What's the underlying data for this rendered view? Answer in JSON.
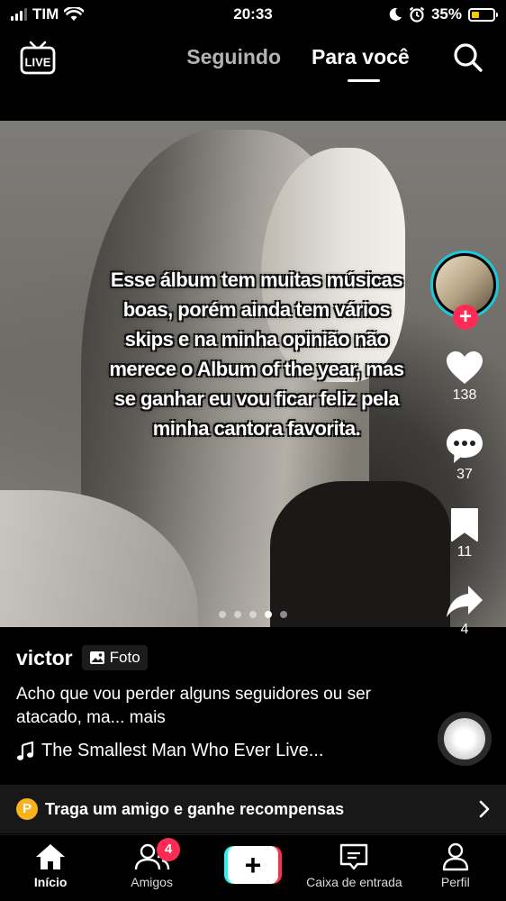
{
  "status_bar": {
    "carrier": "TIM",
    "time": "20:33",
    "battery_percent": "35%",
    "battery_level": 0.35,
    "icons": [
      "signal-icon",
      "wifi-icon",
      "moon-icon",
      "alarm-icon",
      "battery-icon"
    ]
  },
  "header": {
    "live_icon_label": "LIVE",
    "tabs": [
      {
        "label": "Seguindo",
        "active": false
      },
      {
        "label": "Para você",
        "active": true
      }
    ]
  },
  "post": {
    "overlay_text": "Esse álbum tem muitas músicas boas, porém ainda tem vários skips e na minha opinião não merece o Album of the year, mas se ganhar eu vou ficar feliz pela minha cantora favorita.",
    "pager": {
      "total": 5,
      "active_index": 3
    },
    "username": "victor",
    "badge": "Foto",
    "caption": "Acho que vou perder alguns seguidores ou ser atacado, ma... mais",
    "music": "The Smallest Man Who Ever Live..."
  },
  "actions": {
    "likes": "138",
    "comments": "37",
    "saves": "11",
    "shares": "4"
  },
  "promo": {
    "coin_label": "P",
    "text": "Traga um amigo e ganhe recompensas"
  },
  "tab_bar": {
    "items": [
      {
        "label": "Início",
        "icon": "home-icon",
        "active": true
      },
      {
        "label": "Amigos",
        "icon": "friends-icon",
        "badge": "4"
      },
      {
        "label": "",
        "icon": "create-icon"
      },
      {
        "label": "Caixa de entrada",
        "icon": "inbox-icon"
      },
      {
        "label": "Perfil",
        "icon": "profile-icon"
      }
    ]
  },
  "colors": {
    "accent_red": "#fe2c55",
    "accent_cyan": "#25f4ee",
    "coin": "#f7b21d",
    "battery": "#f5c60a"
  }
}
